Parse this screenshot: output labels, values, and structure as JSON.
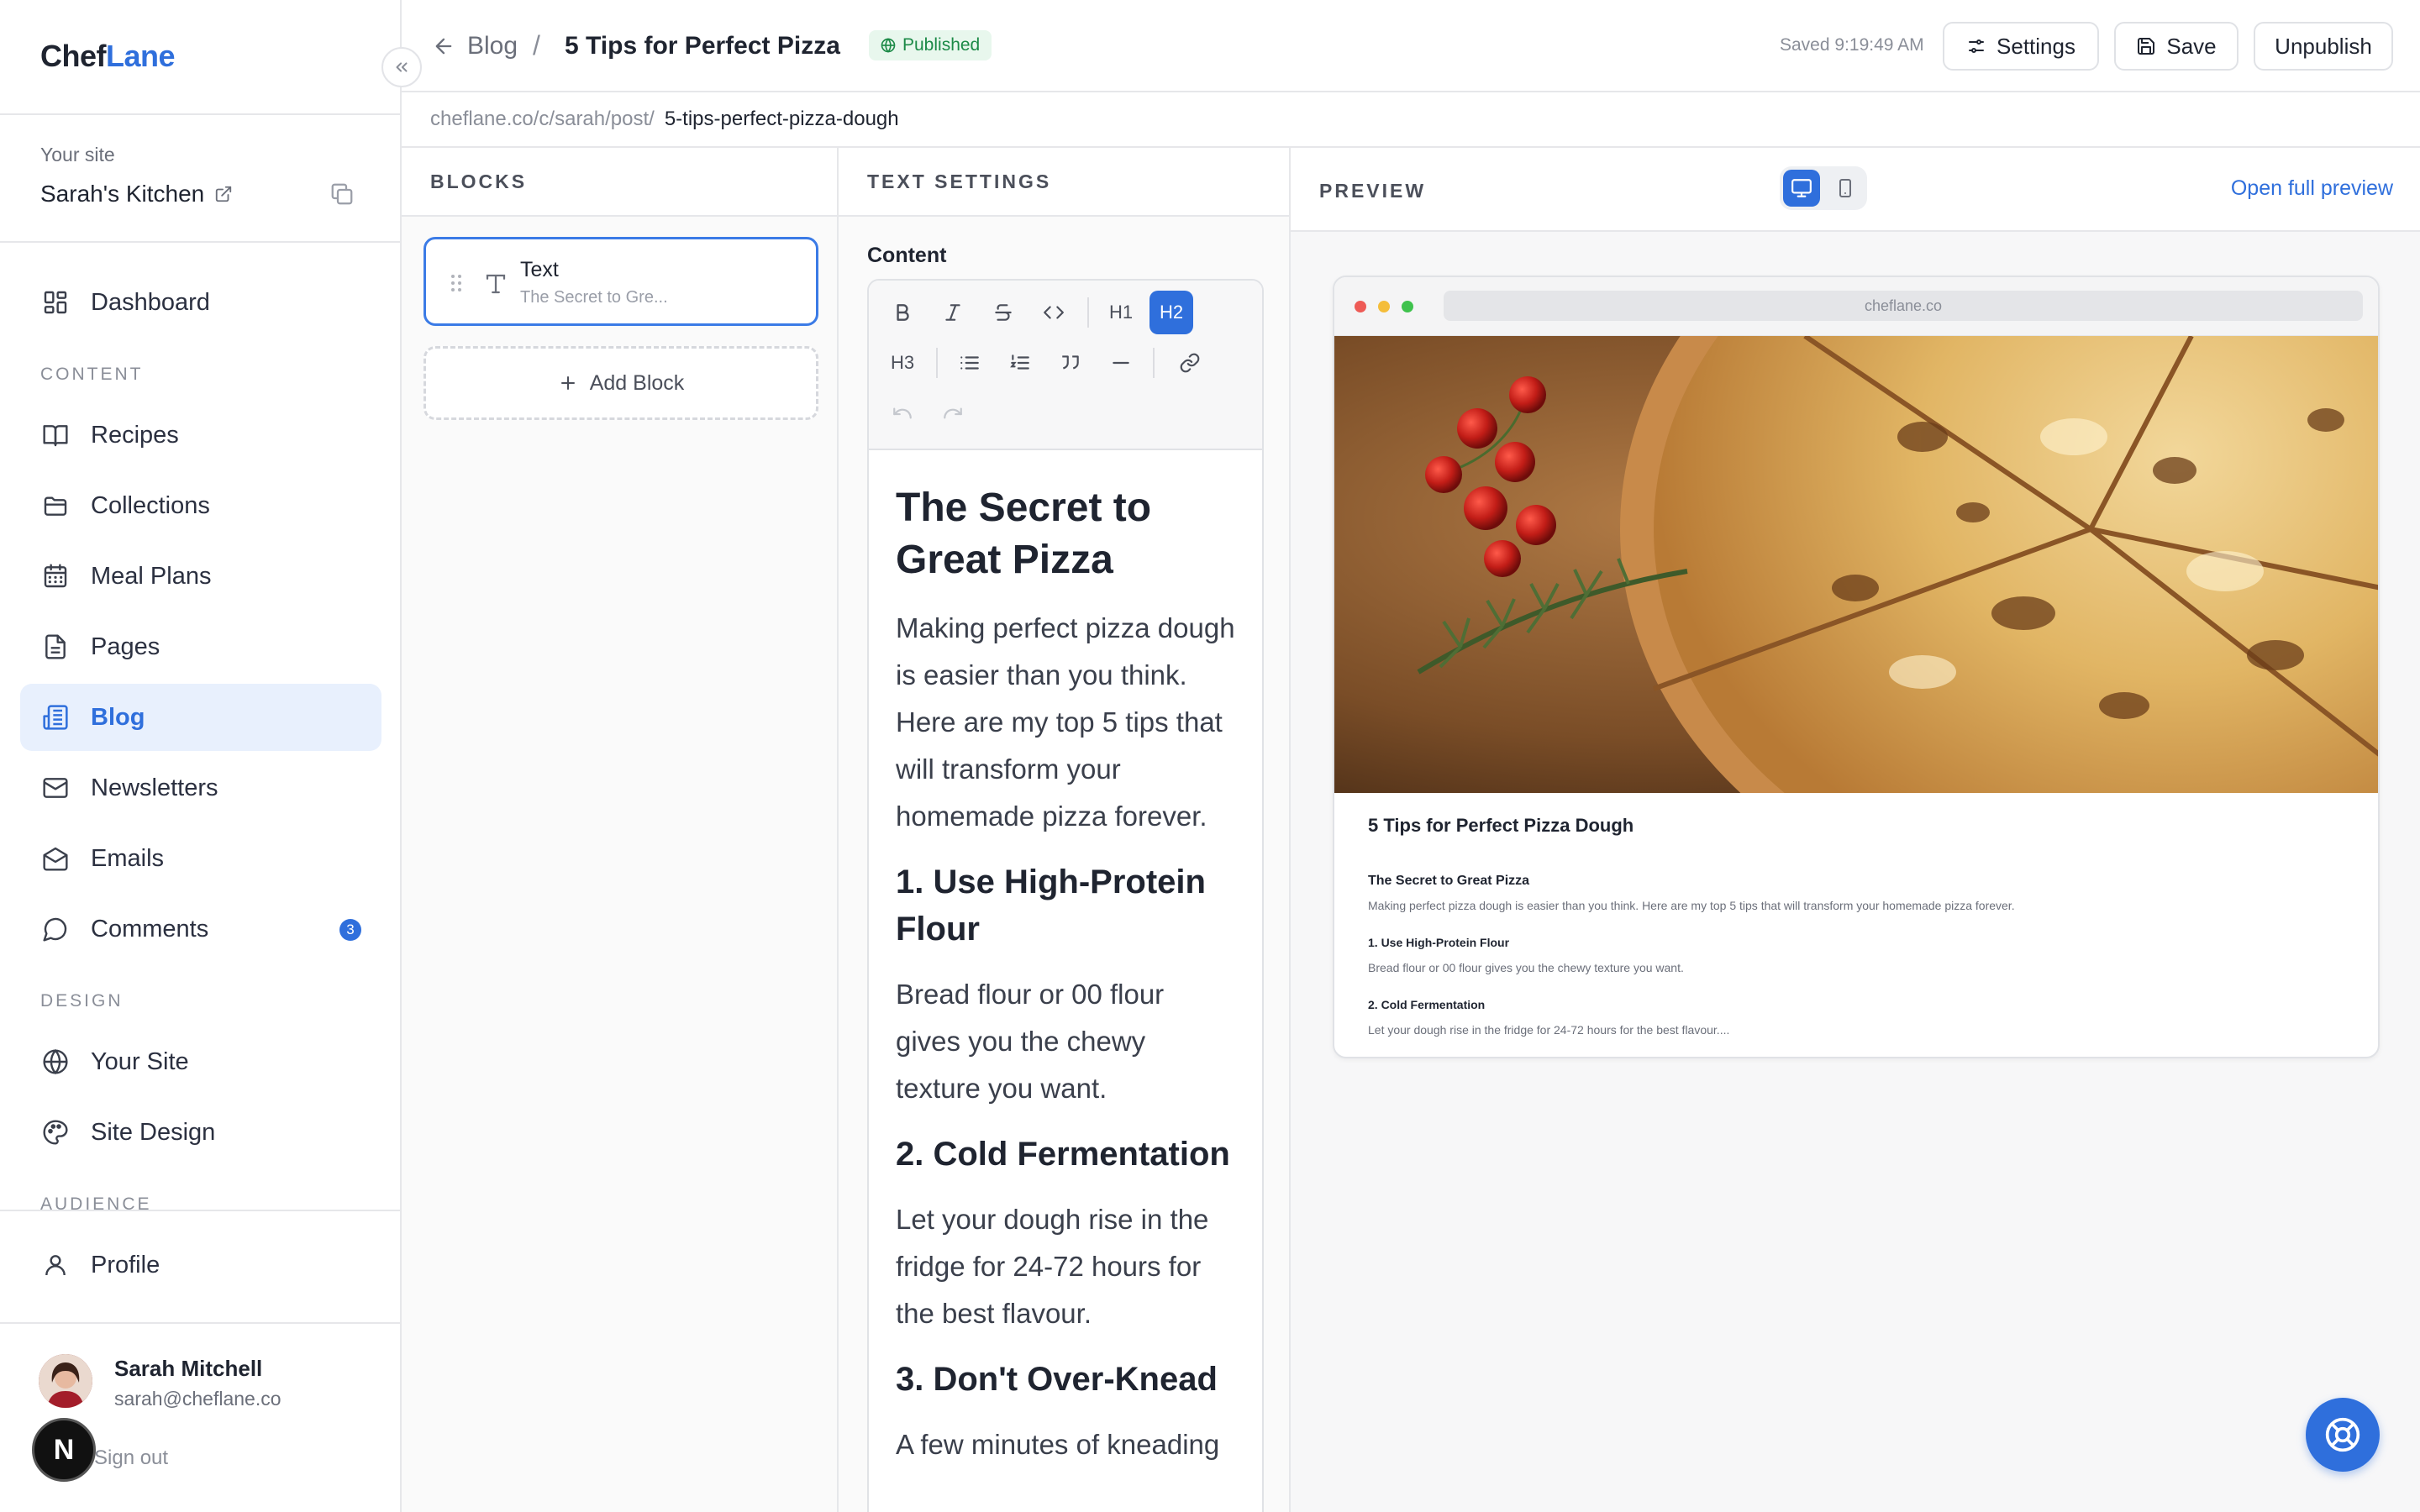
{
  "brand": {
    "part1": "Chef",
    "part2": "Lane"
  },
  "site": {
    "label": "Your site",
    "name": "Sarah's Kitchen"
  },
  "nav": {
    "dashboard": "Dashboard",
    "section_content": "CONTENT",
    "recipes": "Recipes",
    "collections": "Collections",
    "meal_plans": "Meal Plans",
    "pages": "Pages",
    "blog": "Blog",
    "newsletters": "Newsletters",
    "emails": "Emails",
    "comments": "Comments",
    "comments_count": "3",
    "section_design": "DESIGN",
    "your_site": "Your Site",
    "site_design": "Site Design",
    "section_audience": "AUDIENCE",
    "profile": "Profile"
  },
  "user": {
    "name": "Sarah Mitchell",
    "email": "sarah@cheflane.co",
    "sign_out": "Sign out",
    "badge_letter": "N"
  },
  "topbar": {
    "back_label": "Blog",
    "separator": "/",
    "doc_title": "5 Tips for Perfect Pizza Dough",
    "status": "Published",
    "saved": "Saved 9:19:49 AM",
    "settings": "Settings",
    "save": "Save",
    "unpublish": "Unpublish"
  },
  "url": {
    "base": "cheflane.co/c/sarah/post/",
    "slug": "5-tips-perfect-pizza-dough"
  },
  "blocks": {
    "title": "BLOCKS",
    "items": [
      {
        "type": "Text",
        "preview": "The Secret to Gre..."
      }
    ],
    "add_label": "Add Block"
  },
  "text_settings": {
    "title": "TEXT SETTINGS",
    "content_label": "Content",
    "toolbar": {
      "h1": "H1",
      "h2": "H2",
      "h3": "H3",
      "active": "H2"
    }
  },
  "editor": {
    "h_main": "The Secret to Great Pizza",
    "intro": "Making perfect pizza dough is easier than you think. Here are my top 5 tips that will transform your homemade pizza forever.",
    "tip1_title": "1. Use High-Protein Flour",
    "tip1_text": "Bread flour or 00 flour gives you the chewy texture you want.",
    "tip2_title": "2. Cold Fermentation",
    "tip2_text": "Let your dough rise in the fridge for 24-72 hours for the best flavour.",
    "tip3_title": "3. Don't Over-Knead",
    "tip3_text": "A few minutes of kneading"
  },
  "preview": {
    "title": "PREVIEW",
    "open_full": "Open full preview",
    "device": "desktop",
    "address": "cheflane.co",
    "post_title": "5 Tips for Perfect Pizza Dough",
    "h_main": "The Secret to Great Pizza",
    "intro": "Making perfect pizza dough is easier than you think. Here are my top 5 tips that will transform your homemade pizza forever.",
    "tip1_title": "1. Use High-Protein Flour",
    "tip1_text": "Bread flour or 00 flour gives you the chewy texture you want.",
    "tip2_title": "2. Cold Fermentation",
    "tip2_text": "Let your dough rise in the fridge for 24-72 hours for the best flavour...."
  },
  "colors": {
    "accent": "#2f6fdc",
    "published_bg": "#e8f7ed",
    "published_text": "#1c8a47"
  },
  "icons": [
    "collapse-icon",
    "external-link-icon",
    "copy-icon",
    "dashboard-icon",
    "book-icon",
    "folder-icon",
    "calendar-icon",
    "page-icon",
    "blog-icon",
    "mail-icon",
    "mail-open-icon",
    "comment-icon",
    "globe-icon",
    "palette-icon",
    "user-icon",
    "arrow-left-icon",
    "settings-sliders-icon",
    "save-icon",
    "drag-handle-icon",
    "text-icon",
    "plus-icon",
    "desktop-icon",
    "mobile-icon",
    "help-icon"
  ]
}
